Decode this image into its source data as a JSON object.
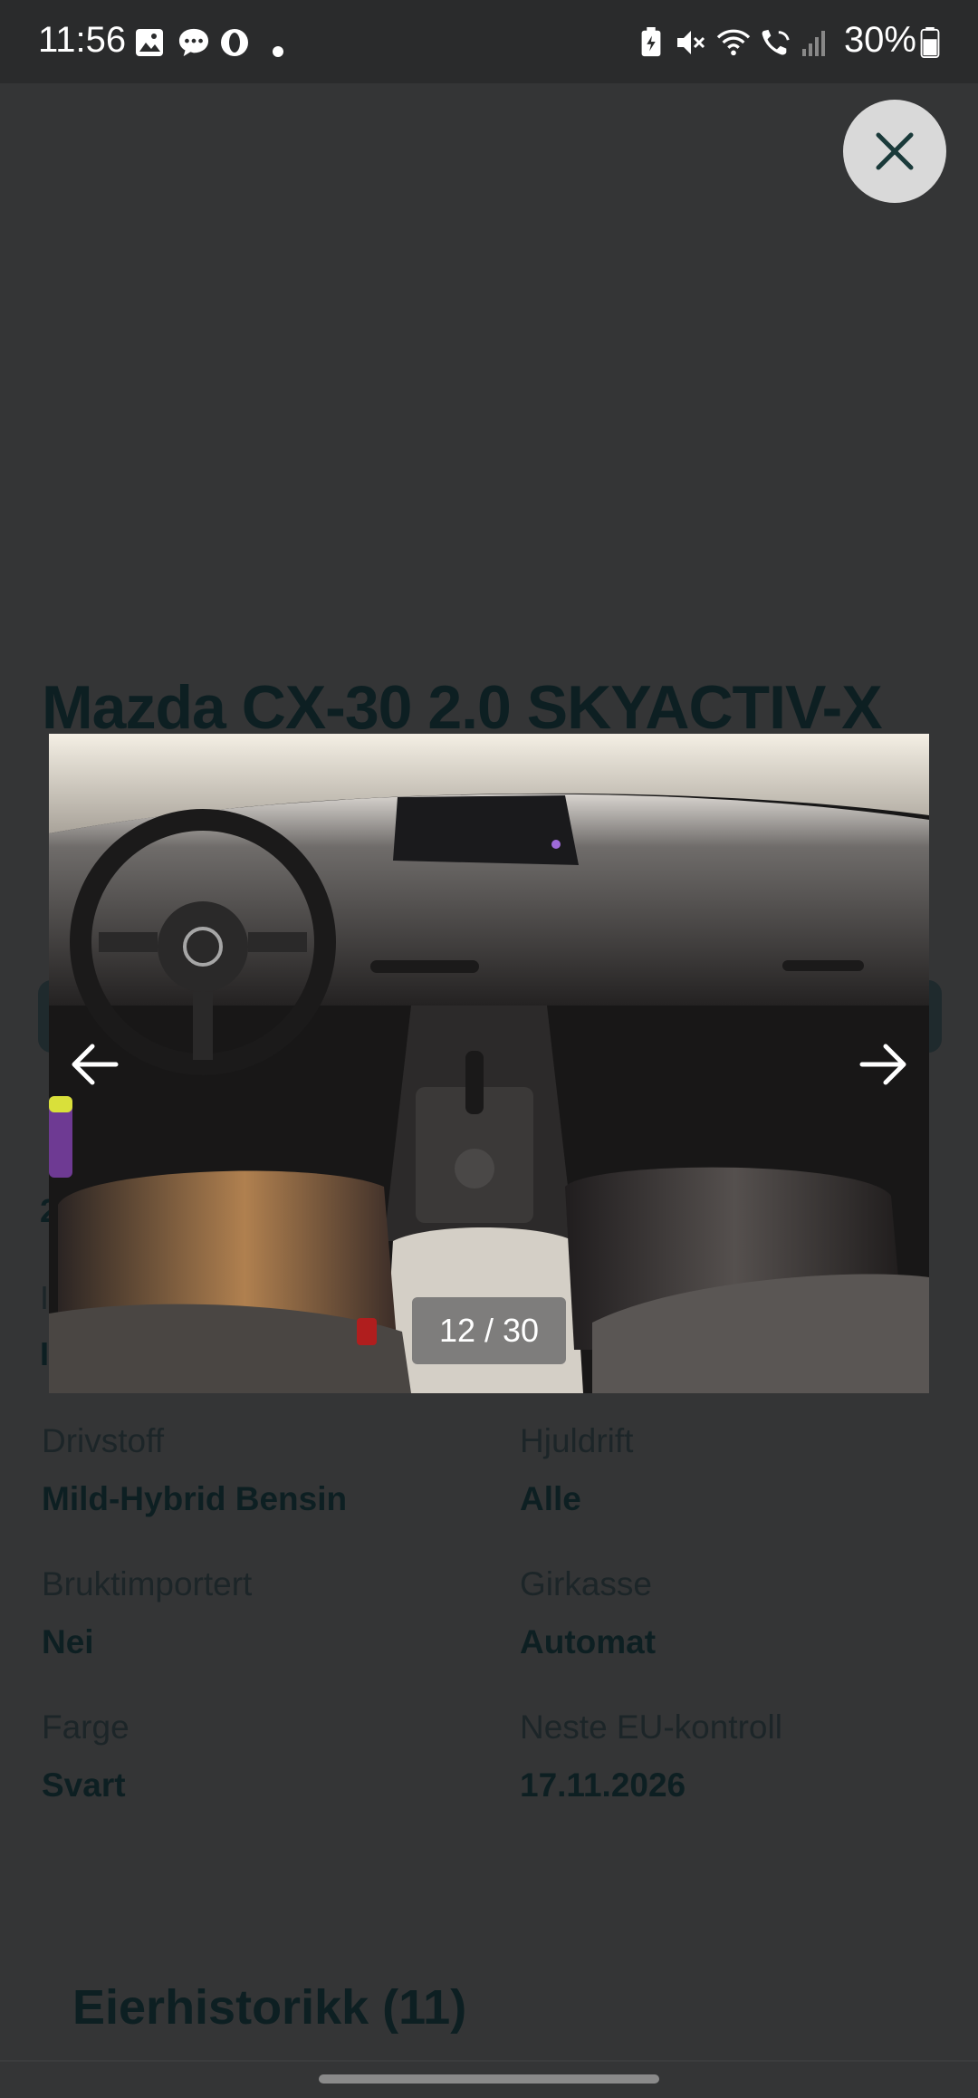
{
  "status_bar": {
    "time": "11:56",
    "battery_percent": "30%",
    "left_icons": [
      "gallery-icon",
      "chat-icon",
      "opera-icon",
      "dot-icon"
    ],
    "right_icons": [
      "battery-saver-icon",
      "mute-icon",
      "wifi-icon",
      "wifi-call-icon",
      "signal-icon",
      "battery-icon"
    ]
  },
  "listing": {
    "title": "Mazda CX-30 2.0 SKYACTIV-X",
    "specs": [
      {
        "label": "Drivstoff",
        "value": "Mild-Hybrid Bensin"
      },
      {
        "label": "Hjuldrift",
        "value": "Alle"
      },
      {
        "label": "Bruktimportert",
        "value": "Nei"
      },
      {
        "label": "Girkasse",
        "value": "Automat"
      },
      {
        "label": "Farge",
        "value": "Svart"
      },
      {
        "label": "Neste EU-kontroll",
        "value": "17.11.2026"
      }
    ],
    "owner_history_title": "Eierhistorikk (11)"
  },
  "gallery": {
    "counter": "12 / 30",
    "current": 12,
    "total": 30
  }
}
